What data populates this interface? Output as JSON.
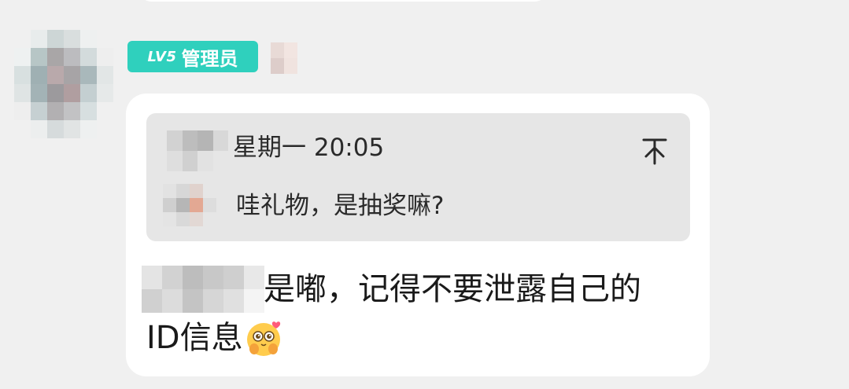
{
  "sender": {
    "badge_level": "LV5",
    "badge_role": "管理员",
    "badge_color": "#2fd0bd"
  },
  "quote": {
    "time": "星期一 20:05",
    "text": "哇礼物，是抽奖嘛?",
    "action_icon": "pin-to-top-icon"
  },
  "message": {
    "line1": "是嘟，记得不要泄露自己的",
    "line2": "ID信息",
    "emoji": "pleading-hands-emoji"
  },
  "colors": {
    "background": "#f0f0f0",
    "bubble": "#ffffff",
    "quote_bg": "#e6e6e6"
  }
}
